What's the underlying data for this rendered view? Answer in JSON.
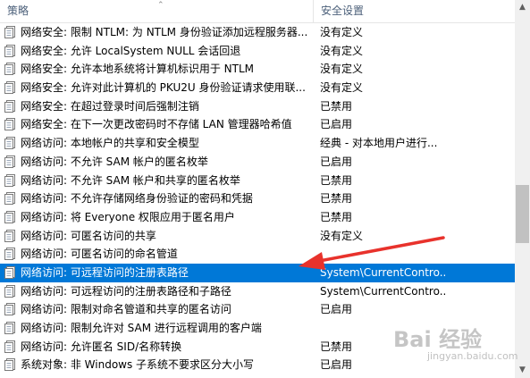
{
  "header": {
    "col_policy": "策略",
    "col_setting": "安全设置"
  },
  "rows": [
    {
      "name": "网络安全: 限制 NTLM: 为 NTLM 身份验证添加远程服务器...",
      "setting": "没有定义"
    },
    {
      "name": "网络安全: 允许 LocalSystem NULL 会话回退",
      "setting": "没有定义"
    },
    {
      "name": "网络安全: 允许本地系统将计算机标识用于 NTLM",
      "setting": "没有定义"
    },
    {
      "name": "网络安全: 允许对此计算机的 PKU2U 身份验证请求使用联...",
      "setting": "没有定义"
    },
    {
      "name": "网络安全: 在超过登录时间后强制注销",
      "setting": "已禁用"
    },
    {
      "name": "网络安全: 在下一次更改密码时不存储 LAN 管理器哈希值",
      "setting": "已启用"
    },
    {
      "name": "网络访问: 本地帐户的共享和安全模型",
      "setting": "经典 - 对本地用户进行..."
    },
    {
      "name": "网络访问: 不允许 SAM 帐户的匿名枚举",
      "setting": "已启用"
    },
    {
      "name": "网络访问: 不允许 SAM 帐户和共享的匿名枚举",
      "setting": "已禁用"
    },
    {
      "name": "网络访问: 不允许存储网络身份验证的密码和凭据",
      "setting": "已禁用"
    },
    {
      "name": "网络访问: 将 Everyone 权限应用于匿名用户",
      "setting": "已禁用"
    },
    {
      "name": "网络访问: 可匿名访问的共享",
      "setting": "没有定义"
    },
    {
      "name": "网络访问: 可匿名访问的命名管道",
      "setting": ""
    },
    {
      "name": "网络访问: 可远程访问的注册表路径",
      "setting": "System\\CurrentContro...",
      "selected": true
    },
    {
      "name": "网络访问: 可远程访问的注册表路径和子路径",
      "setting": "System\\CurrentContro..."
    },
    {
      "name": "网络访问: 限制对命名管道和共享的匿名访问",
      "setting": "已启用"
    },
    {
      "name": "网络访问: 限制允许对 SAM 进行远程调用的客户端",
      "setting": ""
    },
    {
      "name": "网络访问: 允许匿名 SID/名称转换",
      "setting": "已禁用"
    },
    {
      "name": "系统对象: 非 Windows 子系统不要求区分大小写",
      "setting": "已启用"
    }
  ],
  "watermark": {
    "text": "Bai 经验",
    "sub": "jingyan.baidu.com"
  },
  "colors": {
    "selected_bg": "#0078d7",
    "arrow": "#e8322c",
    "header_text": "#4c607a"
  }
}
